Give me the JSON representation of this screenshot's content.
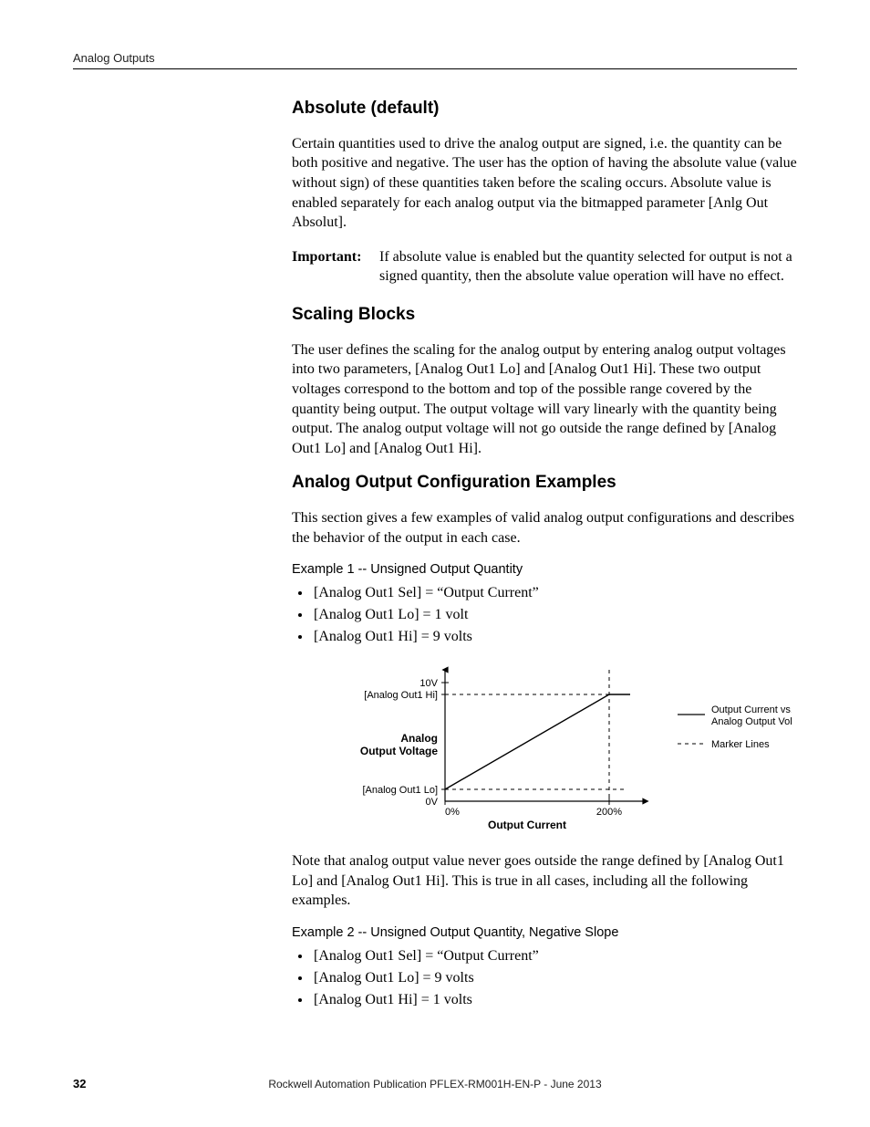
{
  "header": {
    "title": "Analog Outputs"
  },
  "sections": {
    "absolute": {
      "heading": "Absolute (default)",
      "para": "Certain quantities used to drive the analog output are signed, i.e. the quantity can be both positive and negative. The user has the option of having the absolute value (value without sign) of these quantities taken before the scaling occurs. Absolute value is enabled separately for each analog output via the bitmapped parameter [Anlg Out Absolut].",
      "important_label": "Important:",
      "important_text": "If absolute value is enabled but the quantity selected for output is not a signed quantity, then the absolute value operation will have no effect."
    },
    "scaling": {
      "heading": "Scaling Blocks",
      "para": "The user defines the scaling for the analog output by entering analog output voltages into two parameters, [Analog Out1 Lo] and [Analog Out1 Hi]. These two output voltages correspond to the bottom and top of the possible range covered by the quantity being output. The output voltage will vary linearly with the quantity being output. The analog output voltage will not go outside the range defined by [Analog Out1 Lo] and [Analog Out1 Hi]."
    },
    "examples": {
      "heading": "Analog Output Configuration Examples",
      "para": "This section gives a few examples of valid analog output configurations and describes the behavior of the output in each case.",
      "ex1": {
        "title": "Example 1 -- Unsigned Output Quantity",
        "items": [
          "[Analog Out1 Sel] = “Output Current”",
          "[Analog Out1 Lo] = 1 volt",
          "[Analog Out1 Hi] = 9 volts"
        ]
      },
      "note": "Note that analog output value never goes outside the range defined by [Analog Out1 Lo] and [Analog Out1 Hi]. This is true in all cases, including all the following examples.",
      "ex2": {
        "title": "Example 2 -- Unsigned Output Quantity, Negative Slope",
        "items": [
          "[Analog Out1 Sel] = “Output Current”",
          "[Analog Out1 Lo] = 9 volts",
          "[Analog Out1 Hi] = 1 volts"
        ]
      }
    }
  },
  "chart_data": {
    "type": "line",
    "title": "",
    "xlabel": "Output Current",
    "ylabel_lines": [
      "Analog",
      "Output Voltage"
    ],
    "x_ticks": [
      "0%",
      "200%"
    ],
    "y_ticks": [
      "0V",
      "[Analog Out1 Lo]",
      "[Analog Out1 Hi]",
      "10V"
    ],
    "y_tick_values": [
      0,
      1,
      9,
      10
    ],
    "series": [
      {
        "name": "Output Current vs. Analog Output Voltage",
        "x": [
          0,
          200
        ],
        "y": [
          1,
          9
        ]
      }
    ],
    "legend": {
      "items": [
        {
          "style": "solid",
          "label_lines": [
            "Output Current vs.",
            "Analog Output Voltage"
          ]
        },
        {
          "style": "dashed",
          "label_lines": [
            "Marker Lines"
          ]
        }
      ]
    },
    "xlim": [
      0,
      260
    ],
    "ylim": [
      0,
      11
    ]
  },
  "footer": {
    "pub": "Rockwell Automation Publication PFLEX-RM001H-EN-P - June 2013",
    "page": "32"
  }
}
